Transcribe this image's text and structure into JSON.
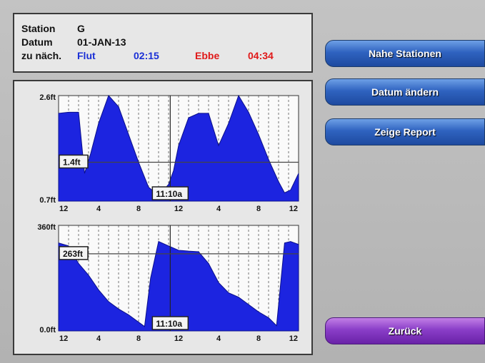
{
  "info": {
    "station_label": "Station",
    "station_value": "G",
    "date_label": "Datum",
    "date_value": "01-JAN-13",
    "next_label": "zu näch.",
    "flood_label": "Flut",
    "flood_time": "02:15",
    "ebb_label": "Ebbe",
    "ebb_time": "04:34",
    "colors": {
      "flood": "#1a2fd6",
      "ebb": "#e01818"
    }
  },
  "buttons": {
    "nearby_stations": "Nahe Stationen",
    "change_date": "Datum ändern",
    "show_report": "Zeige Report",
    "back": "Zurück"
  },
  "chart_data": [
    {
      "type": "area",
      "name": "tide",
      "y_top_label": "2.6ft",
      "y_bottom_label": "0.7ft",
      "ylim": [
        0.7,
        2.6
      ],
      "x_tick_labels": [
        "12",
        "4",
        "8",
        "12",
        "4",
        "8",
        "12"
      ],
      "cursor_value_label": "1.4ft",
      "cursor_value": 1.4,
      "cursor_time_label": "11:10a",
      "x_hours": [
        0,
        1,
        2,
        2.6,
        3.2,
        4,
        5,
        6,
        7,
        8,
        9,
        10,
        11,
        11.5,
        12,
        13,
        14,
        15,
        16,
        17,
        18,
        19,
        20,
        21,
        22,
        22.6,
        23.2,
        24
      ],
      "values": [
        2.28,
        2.3,
        2.3,
        1.2,
        1.55,
        2.1,
        2.6,
        2.4,
        1.9,
        1.4,
        0.95,
        0.8,
        1.0,
        1.25,
        1.7,
        2.2,
        2.28,
        2.28,
        1.7,
        2.1,
        2.6,
        2.3,
        1.9,
        1.45,
        1.05,
        0.85,
        0.9,
        1.2
      ],
      "color": "#1c24e0"
    },
    {
      "type": "area",
      "name": "current",
      "y_top_label": "360ft",
      "y_bottom_label": "0.0ft",
      "ylim": [
        0,
        360
      ],
      "x_tick_labels": [
        "12",
        "4",
        "8",
        "12",
        "4",
        "8",
        "12"
      ],
      "cursor_value_label": "263ft",
      "cursor_value": 263,
      "cursor_time_label": "11:10a",
      "x_hours": [
        0,
        1,
        2,
        3,
        4,
        5,
        6,
        7,
        8,
        8.6,
        9.2,
        10,
        11,
        12,
        13,
        14,
        15,
        16,
        17,
        18,
        19,
        20,
        21,
        21.8,
        22.6,
        23.2,
        24
      ],
      "values": [
        300,
        290,
        230,
        190,
        140,
        100,
        75,
        55,
        30,
        15,
        180,
        305,
        290,
        275,
        272,
        270,
        230,
        165,
        130,
        115,
        90,
        65,
        45,
        18,
        300,
        305,
        295
      ],
      "color": "#1c24e0"
    }
  ]
}
